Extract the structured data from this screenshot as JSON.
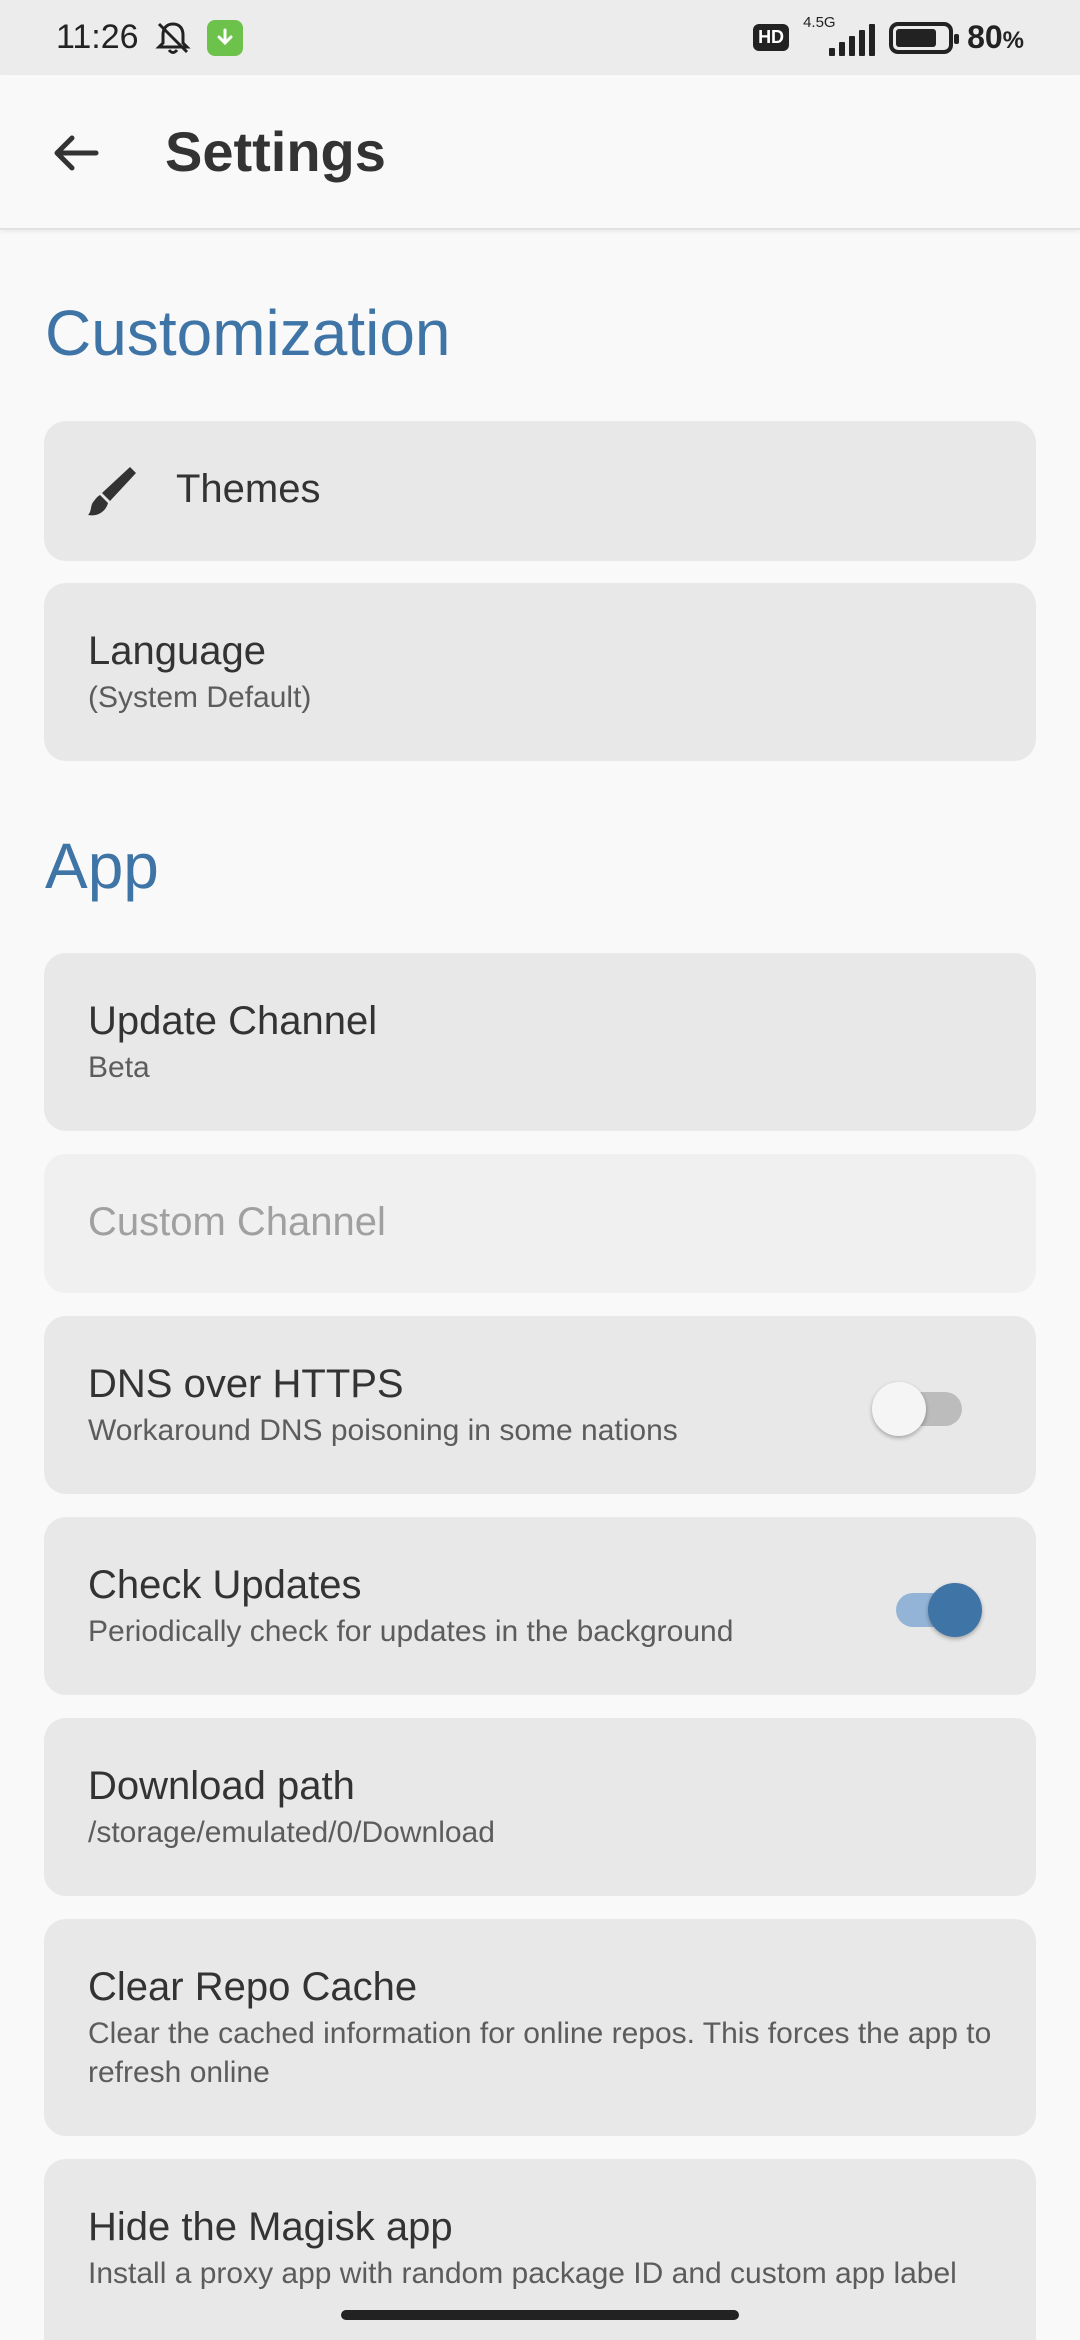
{
  "status_bar": {
    "time": "11:26",
    "network_label": "4.5G",
    "hd_label": "HD",
    "battery_percent": "80",
    "battery_unit": "%",
    "icons": [
      "bell-off-icon",
      "download-badge-icon",
      "hd-icon",
      "signal-icon",
      "battery-icon"
    ]
  },
  "app_bar": {
    "title": "Settings",
    "back_icon": "arrow-left-icon"
  },
  "sections": {
    "customization": {
      "title": "Customization",
      "themes": {
        "label": "Themes",
        "icon": "paintbrush-icon"
      },
      "language": {
        "label": "Language",
        "summary": "(System Default)"
      }
    },
    "app": {
      "title": "App",
      "update_channel": {
        "label": "Update Channel",
        "summary": "Beta"
      },
      "custom_channel": {
        "label": "Custom Channel",
        "enabled": false
      },
      "dns_over_https": {
        "label": "DNS over HTTPS",
        "summary": "Workaround DNS poisoning in some nations",
        "checked": false
      },
      "check_updates": {
        "label": "Check Updates",
        "summary": "Periodically check for updates in the background",
        "checked": true
      },
      "download_path": {
        "label": "Download path",
        "summary": "/storage/emulated/0/Download"
      },
      "clear_repo_cache": {
        "label": "Clear Repo Cache",
        "summary": "Clear the cached information for online repos. This forces the app to refresh online"
      },
      "hide_magisk": {
        "label": "Hide the Magisk app",
        "summary": "Install a proxy app with random package ID and custom app label"
      }
    }
  },
  "colors": {
    "accent": "#3f74a6",
    "card_bg": "#e8e8e8",
    "screen_bg": "#f9f9f9"
  }
}
